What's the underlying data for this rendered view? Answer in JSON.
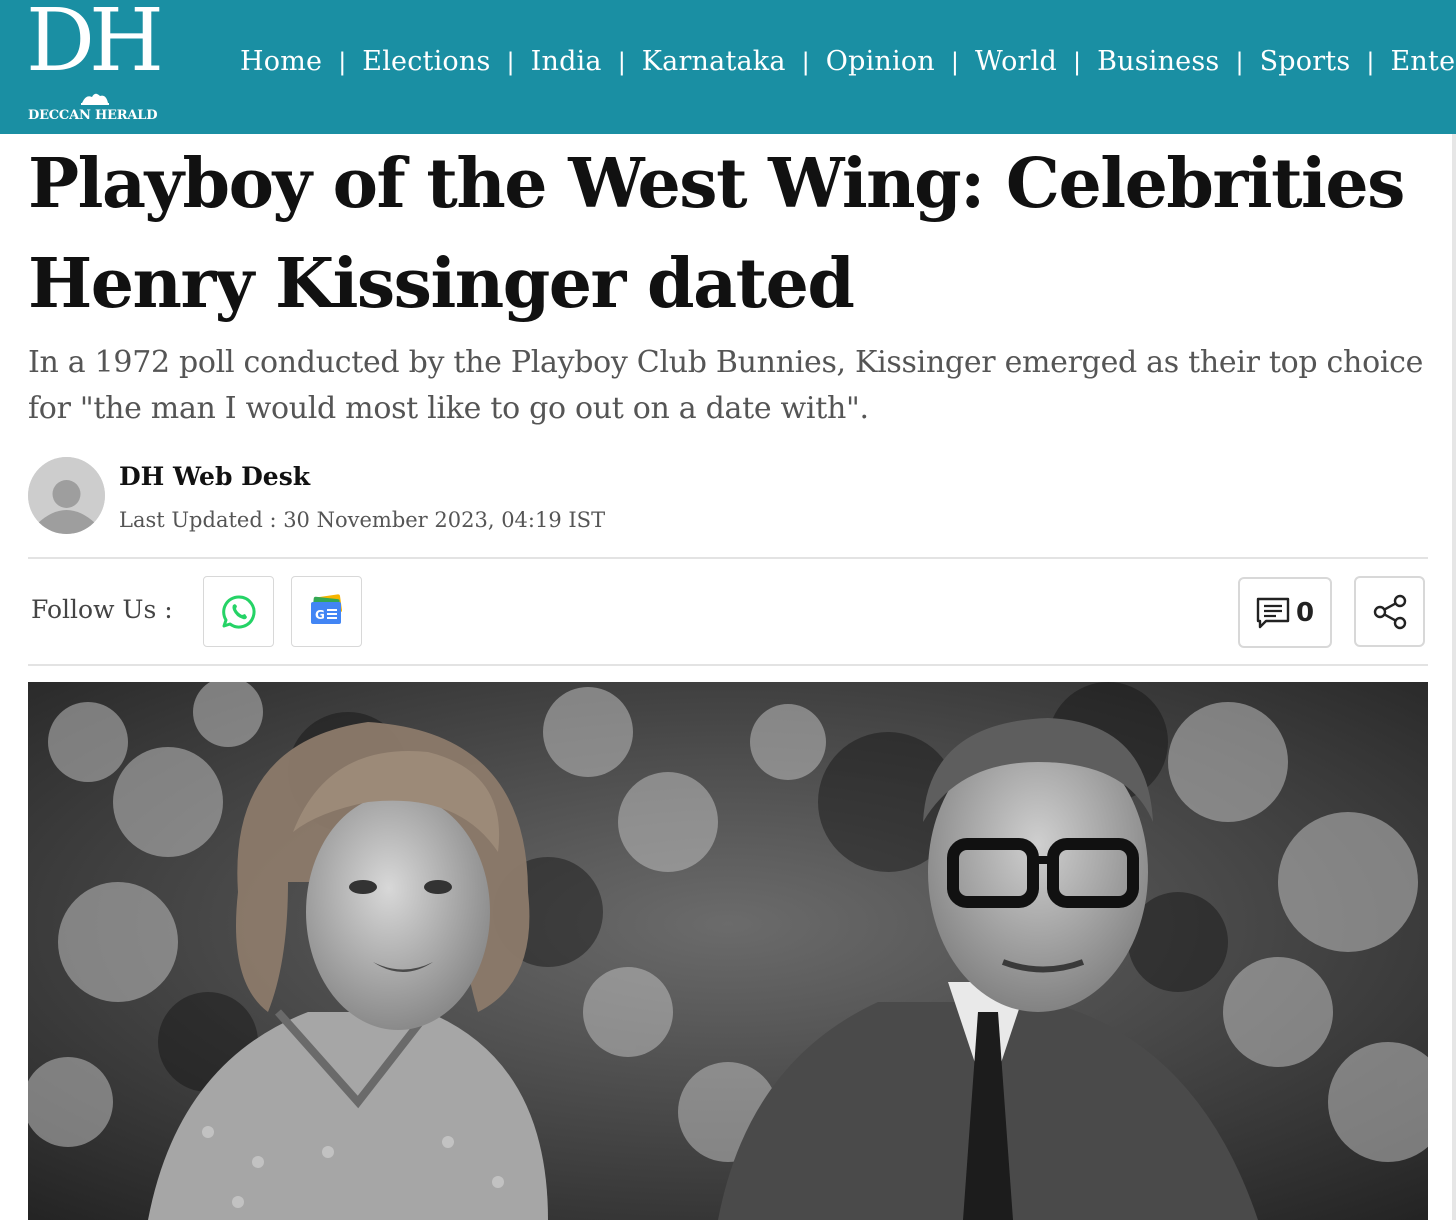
{
  "header": {
    "logo_mark": "DH",
    "logo_text": "DECCAN HERALD",
    "background": "#1a8fa3",
    "nav": [
      {
        "label": "Home"
      },
      {
        "label": "Elections"
      },
      {
        "label": "India"
      },
      {
        "label": "Karnataka"
      },
      {
        "label": "Opinion"
      },
      {
        "label": "World"
      },
      {
        "label": "Business"
      },
      {
        "label": "Sports"
      },
      {
        "label": "Enterta"
      }
    ]
  },
  "article": {
    "headline": "Playboy of the West Wing: Celebrities Henry Kissinger dated",
    "standfirst": "In a 1972 poll conducted by the Playboy Club Bunnies, Kissinger emerged as their top choice for \"the man I would most like to go out on a date with\".",
    "author": "DH Web Desk",
    "updated": "Last Updated : 30 November 2023, 04:19 IST"
  },
  "social": {
    "follow_label": "Follow Us :",
    "icons": [
      "whatsapp-icon",
      "google-news-icon"
    ],
    "comment_count": "0",
    "share_icon": "share-icon"
  },
  "photo": {
    "description_icon": "article-photo"
  }
}
